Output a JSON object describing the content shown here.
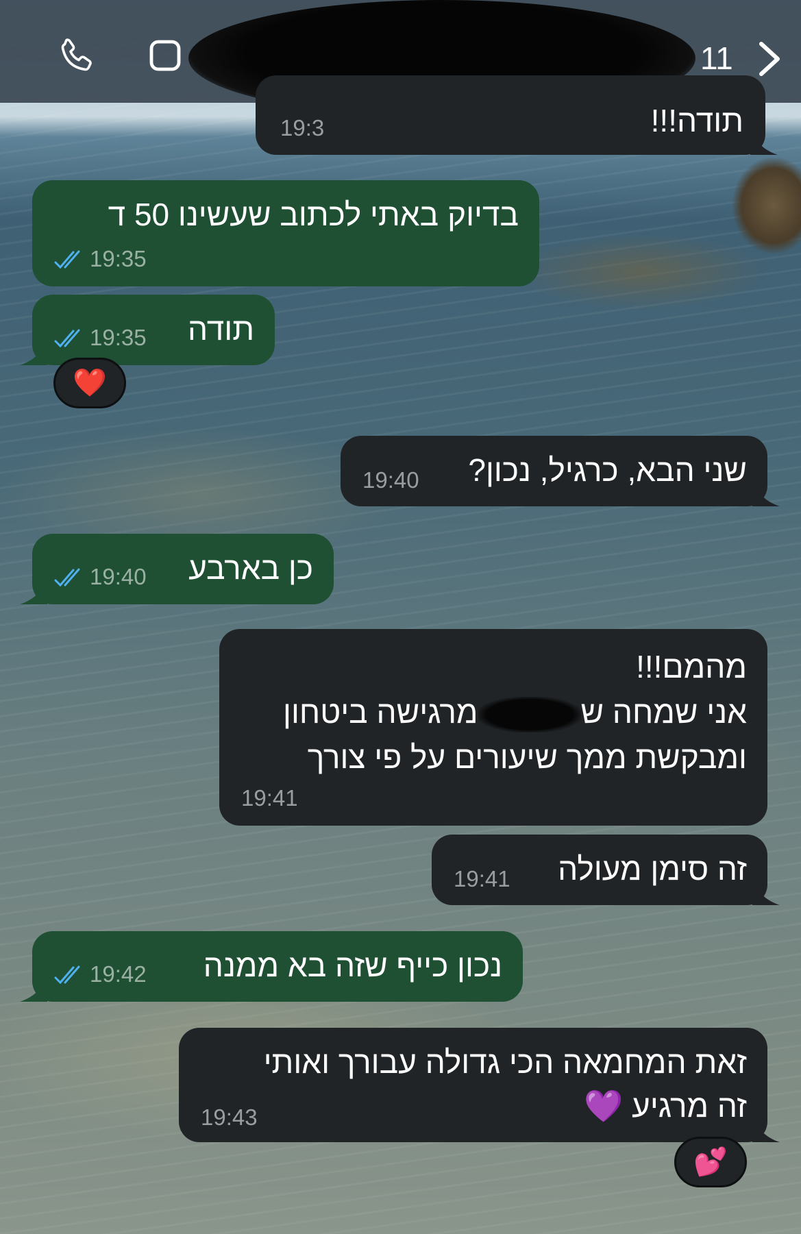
{
  "header": {
    "unread_count": "11",
    "call_icon": "phone-icon",
    "video_icon": "video-camera-icon",
    "back_icon": "chevron-right-icon"
  },
  "messages": [
    {
      "direction": "in",
      "text": "תודה!!!",
      "time": "19:3"
    },
    {
      "direction": "out",
      "text": "בדיוק באתי לכתוב שעשינו 50 ד",
      "time": "19:35",
      "status": "read"
    },
    {
      "direction": "out",
      "text": "תודה",
      "time": "19:35",
      "status": "read",
      "reaction": "❤️"
    },
    {
      "direction": "in",
      "text": "שני הבא, כרגיל, נכון?",
      "time": "19:40"
    },
    {
      "direction": "out",
      "text": "כן בארבע",
      "time": "19:40",
      "status": "read"
    },
    {
      "direction": "in",
      "line1": "מהמם!!!",
      "line2_a": "אני שמחה ש",
      "line2_b": "מרגישה ביטחון",
      "line3": "ומבקשת ממך שיעורים על פי צורך",
      "time": "19:41"
    },
    {
      "direction": "in",
      "text": "זה סימן מעולה",
      "time": "19:41"
    },
    {
      "direction": "out",
      "text": "נכון כייף שזה בא ממנה",
      "time": "19:42",
      "status": "read"
    },
    {
      "direction": "in",
      "line1": "זאת המחמאה הכי גדולה עבורך ואותי",
      "line2": "זה מרגיע 💜",
      "time": "19:43",
      "reaction": "💕"
    }
  ],
  "colors": {
    "outgoing_bubble": "#1f5034",
    "incoming_bubble": "#202427",
    "read_ticks": "#4fb1f0",
    "header": "#3a4652"
  }
}
